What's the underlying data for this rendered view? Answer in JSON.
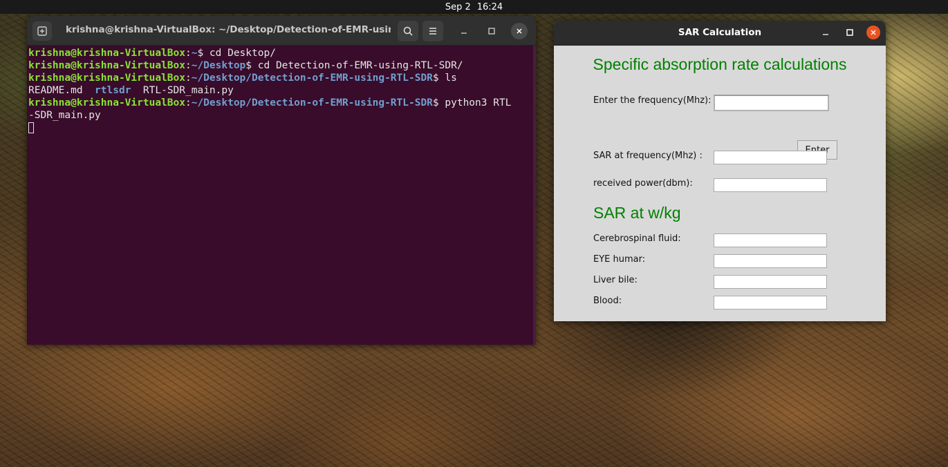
{
  "topbar": {
    "date": "Sep 2",
    "time": "16:24"
  },
  "terminal": {
    "title": "krishna@krishna-VirtualBox: ~/Desktop/Detection-of-EMR-usin...",
    "lines": {
      "l1_user": "krishna@krishna-VirtualBox",
      "l1_sep": ":",
      "l1_path": "~",
      "l1_cmd": "$ cd Desktop/",
      "l2_user": "krishna@krishna-VirtualBox",
      "l2_sep": ":",
      "l2_path": "~/Desktop",
      "l2_cmd": "$ cd Detection-of-EMR-using-RTL-SDR/",
      "l3_user": "krishna@krishna-VirtualBox",
      "l3_sep": ":",
      "l3_path": "~/Desktop/Detection-of-EMR-using-RTL-SDR",
      "l3_cmd": "$ ls",
      "l4_file1": "README.md",
      "l4_dir": "rtlsdr",
      "l4_file2": "RTL-SDR_main.py",
      "l5_user": "krishna@krishna-VirtualBox",
      "l5_sep": ":",
      "l5_path": "~/Desktop/Detection-of-EMR-using-RTL-SDR",
      "l5_cmd": "$ python3 RTL",
      "l6_cont": "-SDR_main.py"
    }
  },
  "sar": {
    "window_title": "SAR Calculation",
    "heading": "Specific absorption rate calculations",
    "frequency_label": "Enter the frequency(Mhz):",
    "frequency_value": "",
    "enter_button": "Enter",
    "sar_freq_label": "SAR at frequency(Mhz) :",
    "sar_freq_value": "",
    "received_power_label": "received power(dbm):",
    "received_power_value": "",
    "subheading": "SAR at w/kg",
    "tissues": {
      "csf_label": "Cerebrospinal fluid:",
      "eye_label": "EYE humar:",
      "liver_label": "Liver bile:",
      "blood_label": "Blood:"
    }
  },
  "colors": {
    "terminal_bg": "#380c2a",
    "prompt_user": "#8ae234",
    "prompt_path": "#729fcf",
    "heading_green": "#008000",
    "close_orange": "#e95420"
  }
}
